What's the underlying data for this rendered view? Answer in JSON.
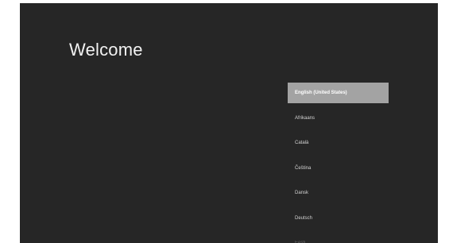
{
  "welcome_title": "Welcome",
  "colors": {
    "background": "#262626",
    "selected_item": "#a3a3a3",
    "text": "#f2f2f2"
  },
  "languages": [
    {
      "label": "English (United States)",
      "selected": true
    },
    {
      "label": "Afrikaans",
      "selected": false
    },
    {
      "label": "Català",
      "selected": false
    },
    {
      "label": "Čeština",
      "selected": false
    },
    {
      "label": "Dansk",
      "selected": false
    },
    {
      "label": "Deutsch",
      "selected": false
    },
    {
      "label": "Eesti",
      "selected": false
    }
  ]
}
